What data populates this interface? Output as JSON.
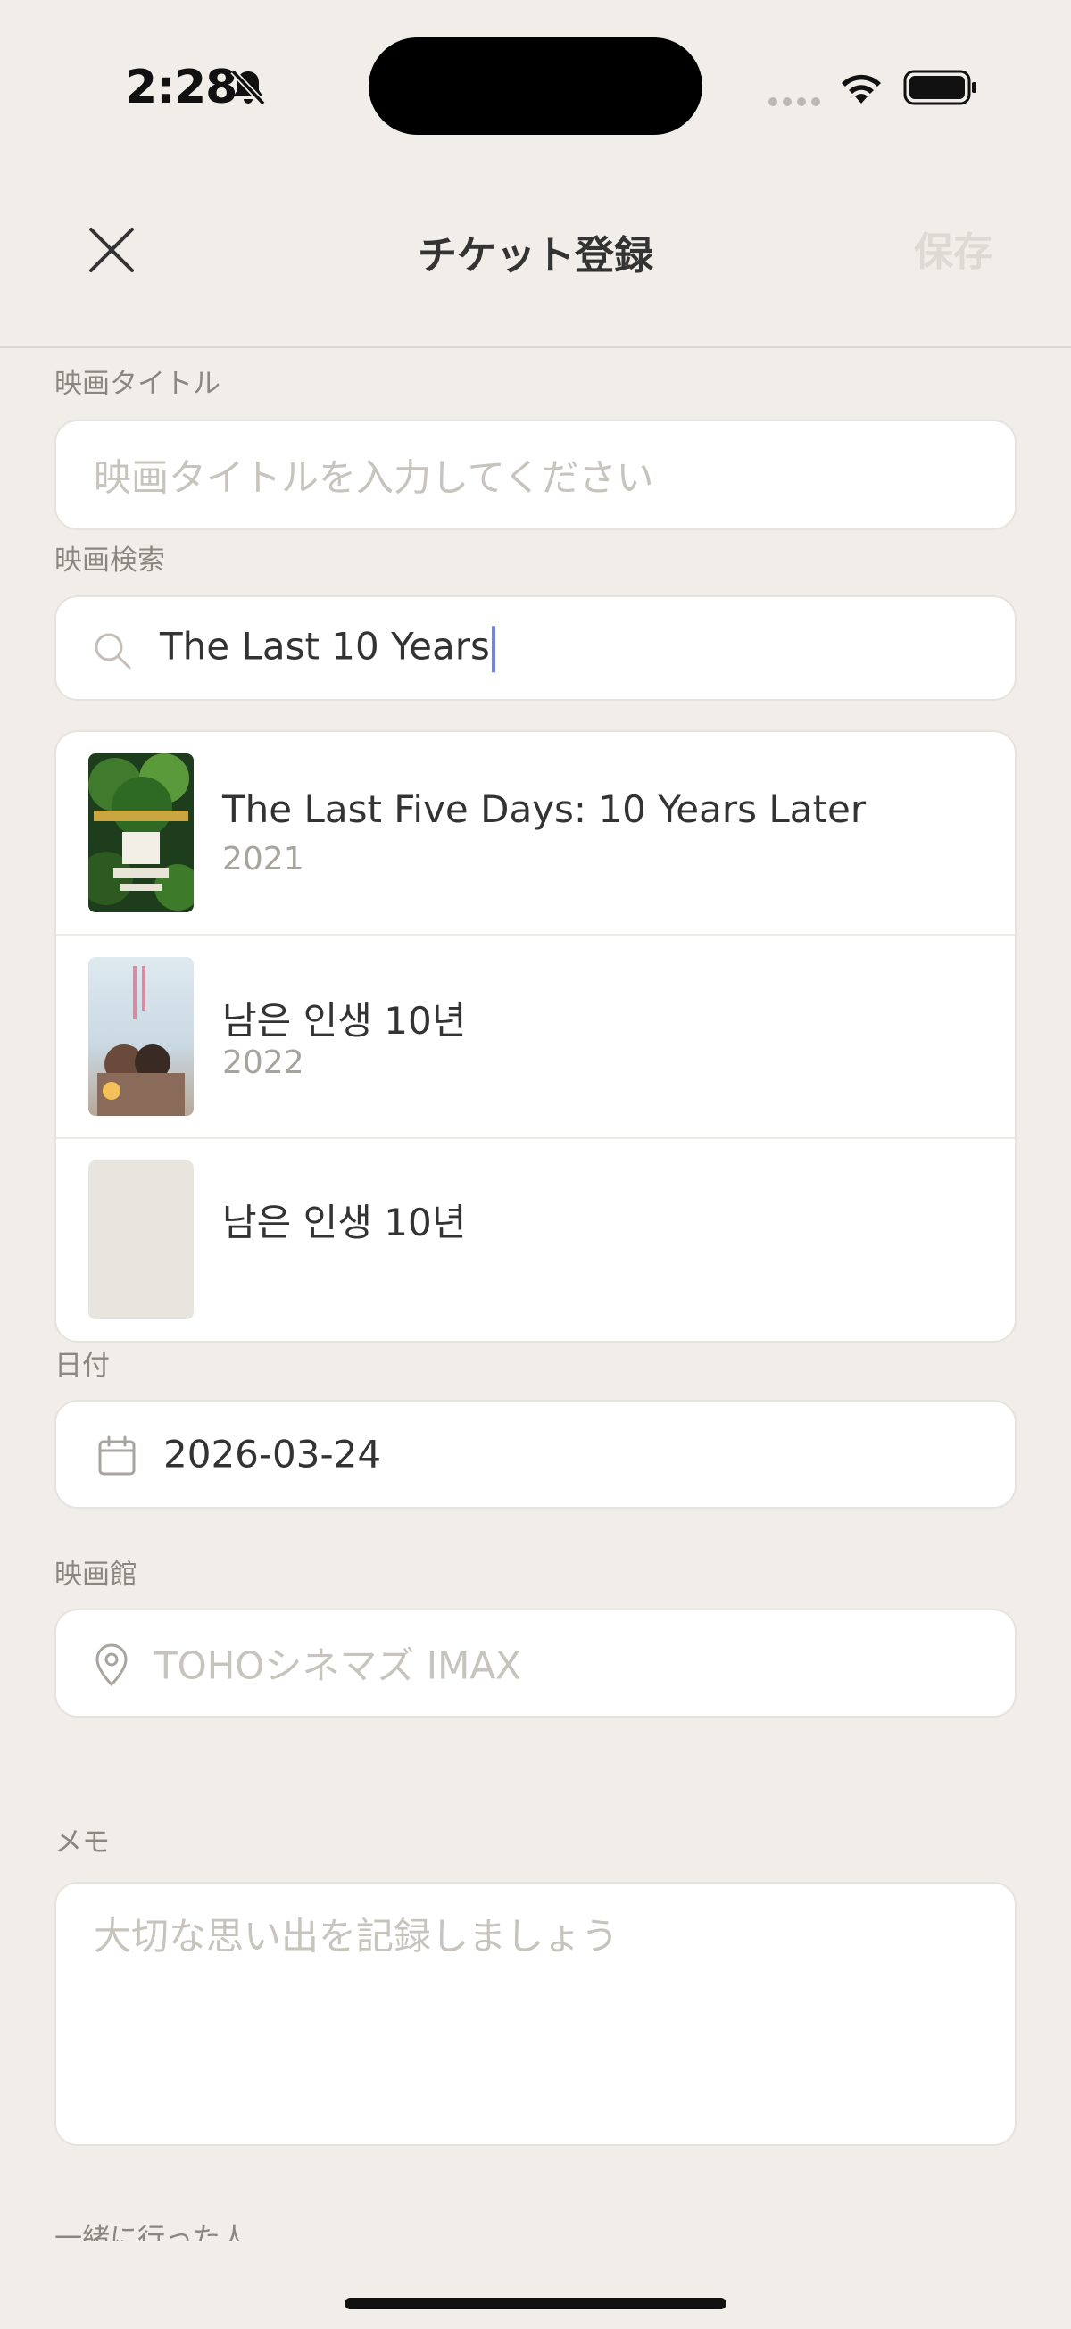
{
  "status_bar": {
    "time": "2:28"
  },
  "nav": {
    "title": "チケット登録",
    "save_label": "保存"
  },
  "form": {
    "title_label": "映画タイトル",
    "title_placeholder": "映画タイトルを入力してください",
    "search_label": "映画検索",
    "search_value": "The Last 10 Years",
    "results": [
      {
        "title": "The Last Five Days: 10 Years Later",
        "year": "2021"
      },
      {
        "title": "남은 인생 10년",
        "year": "2022"
      },
      {
        "title": "남은 인생 10년",
        "year": ""
      }
    ],
    "date_label": "日付",
    "date_value": "2026-03-24",
    "theater_label": "映画館",
    "theater_placeholder": "TOHOシネマズ IMAX",
    "memo_label": "メモ",
    "memo_placeholder": "大切な思い出を記録しましょう",
    "companions_label": "一緒に行った人"
  },
  "icons": [
    "bell-slash-icon",
    "wifi-icon",
    "battery-icon",
    "close-icon",
    "search-icon",
    "calendar-icon",
    "location-pin-icon"
  ],
  "colors": {
    "background": "#f1eee9",
    "cursor": "#6f86e8",
    "save_disabled": "#dedad3"
  }
}
